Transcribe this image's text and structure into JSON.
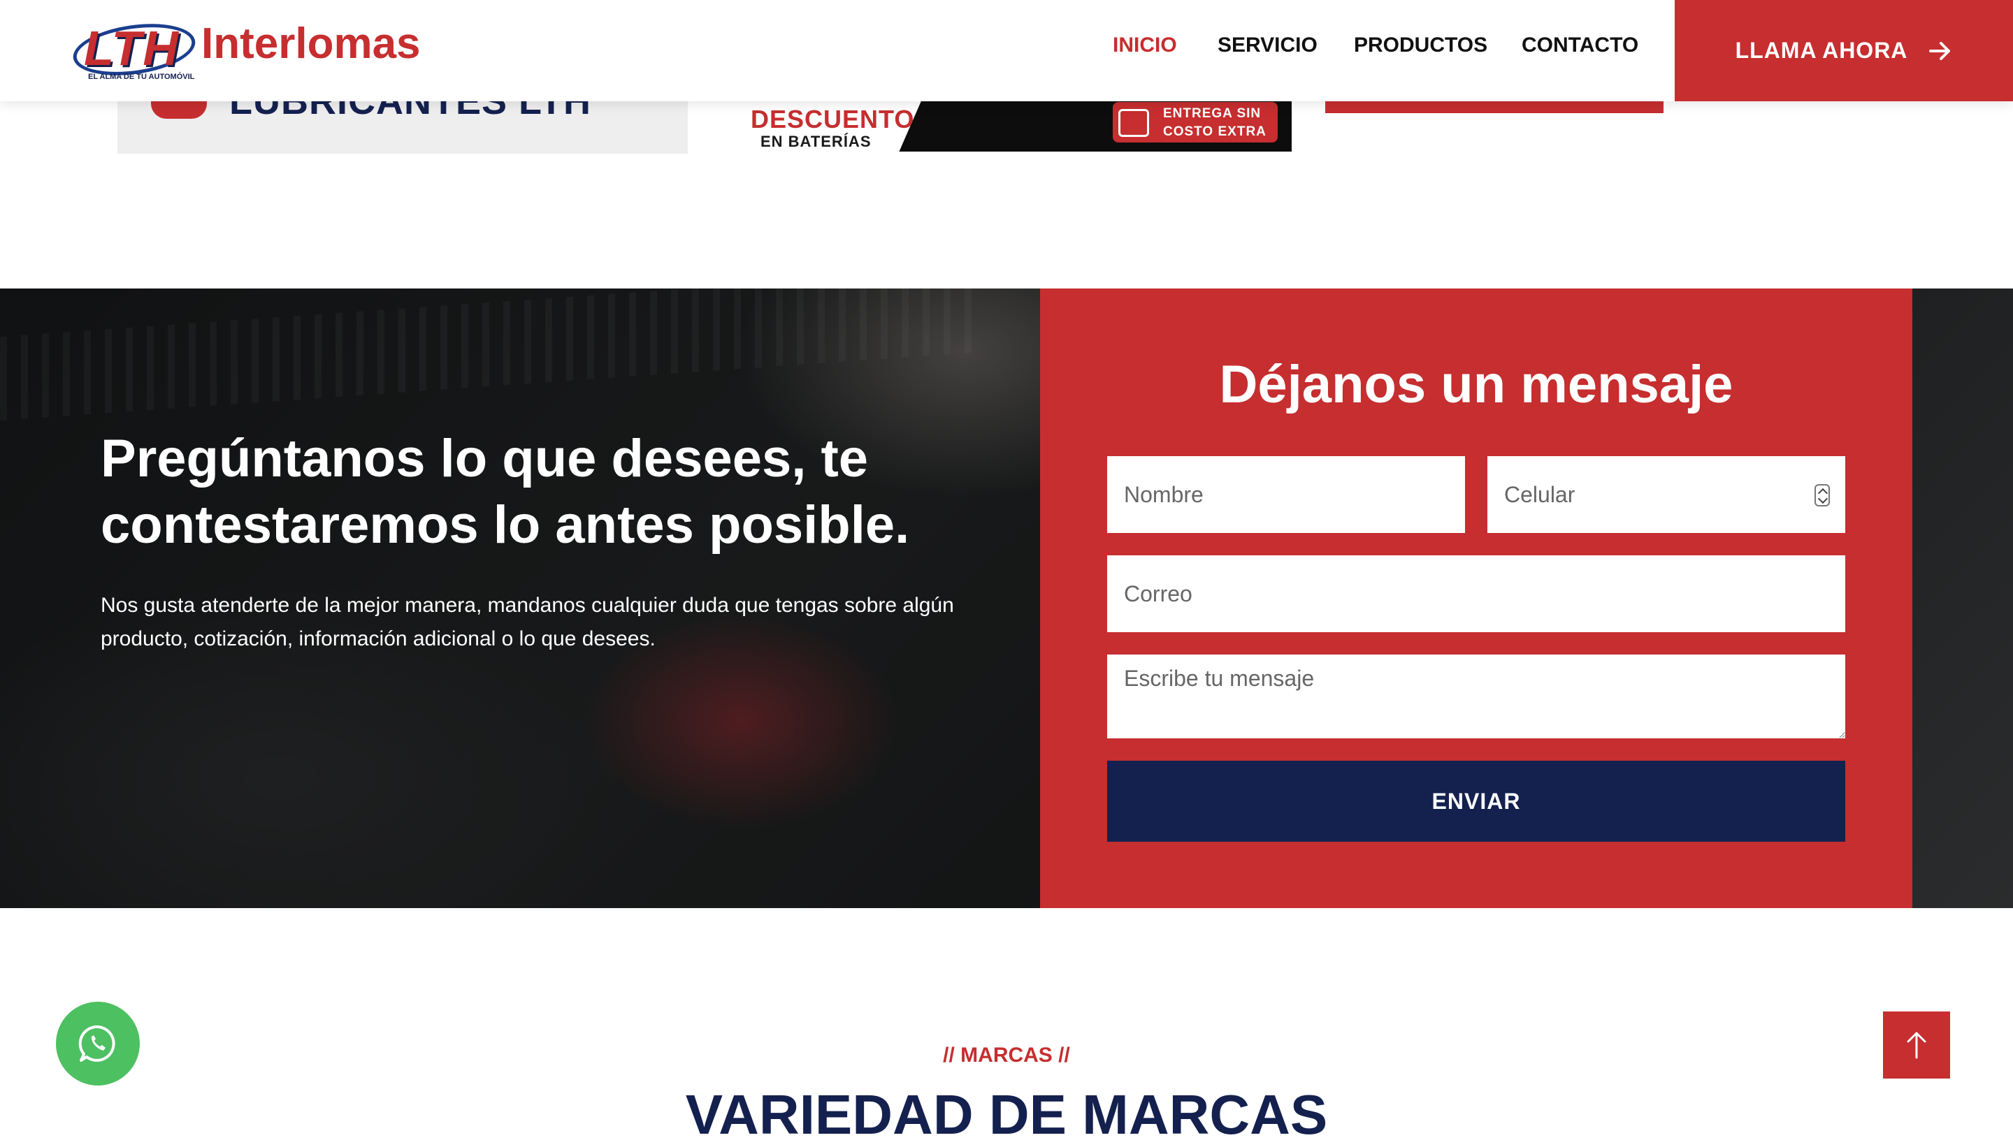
{
  "colors": {
    "brand_red": "#c62e2f",
    "brand_navy": "#14214f",
    "whatsapp_green": "#4dc062",
    "white": "#ffffff"
  },
  "header": {
    "logo_mark": "LTH",
    "logo_tagline": "EL ALMA DE TU AUTOMÓVIL",
    "logo_name": "Interlomas",
    "nav": [
      {
        "label": "INICIO",
        "active": true
      },
      {
        "label": "SERVICIO",
        "active": false
      },
      {
        "label": "PRODUCTOS",
        "active": false
      },
      {
        "label": "CONTACTO",
        "active": false
      }
    ],
    "cta_label": "LLAMA AHORA",
    "cta_icon": "arrow-right-icon"
  },
  "promos": {
    "left_title": "LUBRICANTES LTH",
    "middle_main": "DESCUENTO",
    "middle_sub": "EN BATERÍAS",
    "badge_line1": "ENTREGA SIN",
    "badge_line2": "COSTO EXTRA"
  },
  "contact": {
    "title": "Pregúntanos lo que desees, te contestaremos lo antes posible.",
    "text": "Nos gusta atenderte de la mejor manera, mandanos cualquier duda que tengas sobre algún producto, cotización, información adicional o lo que desees.",
    "form": {
      "title": "Déjanos un mensaje",
      "nombre_placeholder": "Nombre",
      "celular_placeholder": "Celular",
      "correo_placeholder": "Correo",
      "mensaje_placeholder": "Escribe tu mensaje",
      "submit_label": "ENVIAR"
    }
  },
  "brands": {
    "kicker": "// MARCAS //",
    "title": "VARIEDAD DE MARCAS"
  },
  "floating": {
    "whatsapp_icon": "whatsapp-icon",
    "top_icon": "arrow-up-icon"
  }
}
